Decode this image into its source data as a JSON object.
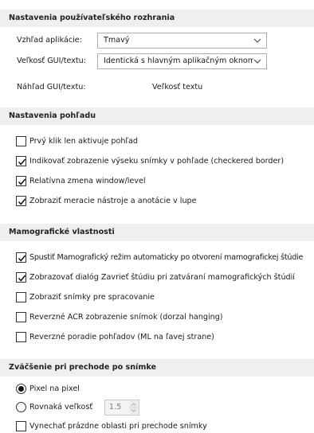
{
  "ui_settings": {
    "header": "Nastavenia používateľského rozhrania",
    "appearance_label": "Vzhľad aplikácie:",
    "appearance_value": "Tmavý",
    "gui_size_label": "Veľkosť GUI/textu:",
    "gui_size_value": "Identická s hlavným aplikačným oknom",
    "preview_label": "Náhľad GUI/textu:",
    "preview_text": "Veľkosť textu"
  },
  "view_settings": {
    "header": "Nastavenia pohľadu",
    "options": [
      {
        "label": "Prvý klik len aktivuje pohľad",
        "checked": false
      },
      {
        "label": "Indikovať zobrazenie výseku snímky v pohľade (checkered border)",
        "checked": true
      },
      {
        "label": "Relatívna zmena window/level",
        "checked": true
      },
      {
        "label": "Zobraziť meracie nástroje a anotácie v lupe",
        "checked": true
      }
    ]
  },
  "mammo": {
    "header": "Mamografické vlastnosti",
    "options": [
      {
        "label": "Spustiť Mamografický režim automaticky po otvorení mamografickej štúdie",
        "checked": true
      },
      {
        "label": "Zobrazovať dialóg Zavrieť štúdiu pri zatváraní mamografických štúdií",
        "checked": true
      },
      {
        "label": "Zobraziť snímky pre spracovanie",
        "checked": false
      },
      {
        "label": "Reverzné ACR zobrazenie snímok (dorzal hanging)",
        "checked": false
      },
      {
        "label": "Reverzné poradie pohľadov (ML na ľavej strane)",
        "checked": false
      }
    ]
  },
  "zoom": {
    "header": "Zväčšenie pri prechode po snímke",
    "radio_pixel": "Pixel na pixel",
    "radio_pixel_selected": true,
    "radio_equal": "Rovnaká veľkosť",
    "radio_equal_selected": false,
    "equal_size_value": "1.5",
    "skip_empty": "Vynechať prázdne oblasti pri prechode snímky",
    "skip_empty_checked": false
  }
}
